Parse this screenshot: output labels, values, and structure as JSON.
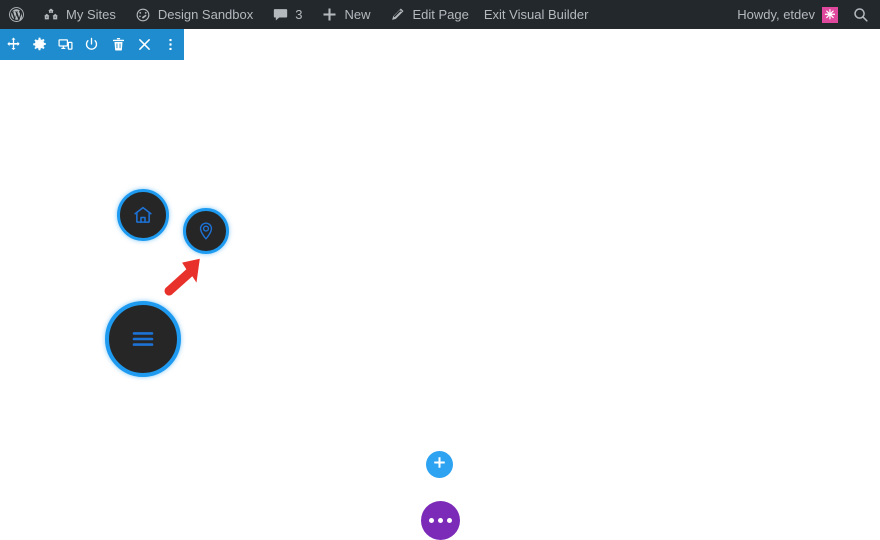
{
  "admin_bar": {
    "background_color": "#23282d",
    "text_color": "#b4b9be",
    "left_items": [
      {
        "id": "wp-logo",
        "icon": "wordpress-logo-icon",
        "label": ""
      },
      {
        "id": "my-sites",
        "icon": "my-sites-icon",
        "label": "My Sites"
      },
      {
        "id": "design-sandbox",
        "icon": "dashboard-speedometer-icon",
        "label": "Design Sandbox"
      },
      {
        "id": "comments",
        "icon": "comment-bubble-icon",
        "label": "3"
      },
      {
        "id": "new-content",
        "icon": "plus-icon",
        "label": "New"
      },
      {
        "id": "edit-page",
        "icon": "pencil-icon",
        "label": "Edit Page"
      },
      {
        "id": "exit-visual-builder",
        "icon": "",
        "label": "Exit Visual Builder"
      }
    ],
    "right": {
      "howdy_label": "Howdy, etdev",
      "avatar_glyph": "✳",
      "avatar_color": "#e0489e",
      "search_icon": "search-icon"
    }
  },
  "visual_builder_toolbar": {
    "background_color": "#1e8cce",
    "buttons": [
      {
        "id": "move",
        "icon": "move-arrows-icon",
        "title": "Move"
      },
      {
        "id": "settings",
        "icon": "gear-icon",
        "title": "Settings"
      },
      {
        "id": "responsive",
        "icon": "responsive-views-icon",
        "title": "Responsive Views"
      },
      {
        "id": "wireframe",
        "icon": "power-toggle-icon",
        "title": "Wireframe Mode"
      },
      {
        "id": "trash",
        "icon": "trash-icon",
        "title": "Delete"
      },
      {
        "id": "close",
        "icon": "close-x-icon",
        "title": "Close"
      },
      {
        "id": "more",
        "icon": "vertical-dots-icon",
        "title": "More Options"
      }
    ]
  },
  "canvas": {
    "background_color": "#ffffff",
    "icon_buttons": [
      {
        "id": "home",
        "icon": "home-icon",
        "border_color": "#1e9bf0",
        "fill_color": "#262626"
      },
      {
        "id": "location",
        "icon": "map-pin-icon",
        "border_color": "#1e9bf0",
        "fill_color": "#262626"
      },
      {
        "id": "menu",
        "icon": "hamburger-menu-icon",
        "border_color": "#1e9bf0",
        "fill_color": "#262626"
      }
    ],
    "annotation": {
      "type": "arrow",
      "color": "#e8312a",
      "points_to": "location"
    },
    "floating_buttons": [
      {
        "id": "add-section",
        "icon": "plus-icon",
        "color": "#2ea3f2"
      },
      {
        "id": "page-settings",
        "icon": "ellipsis-icon",
        "color": "#7b2bb8"
      }
    ]
  }
}
